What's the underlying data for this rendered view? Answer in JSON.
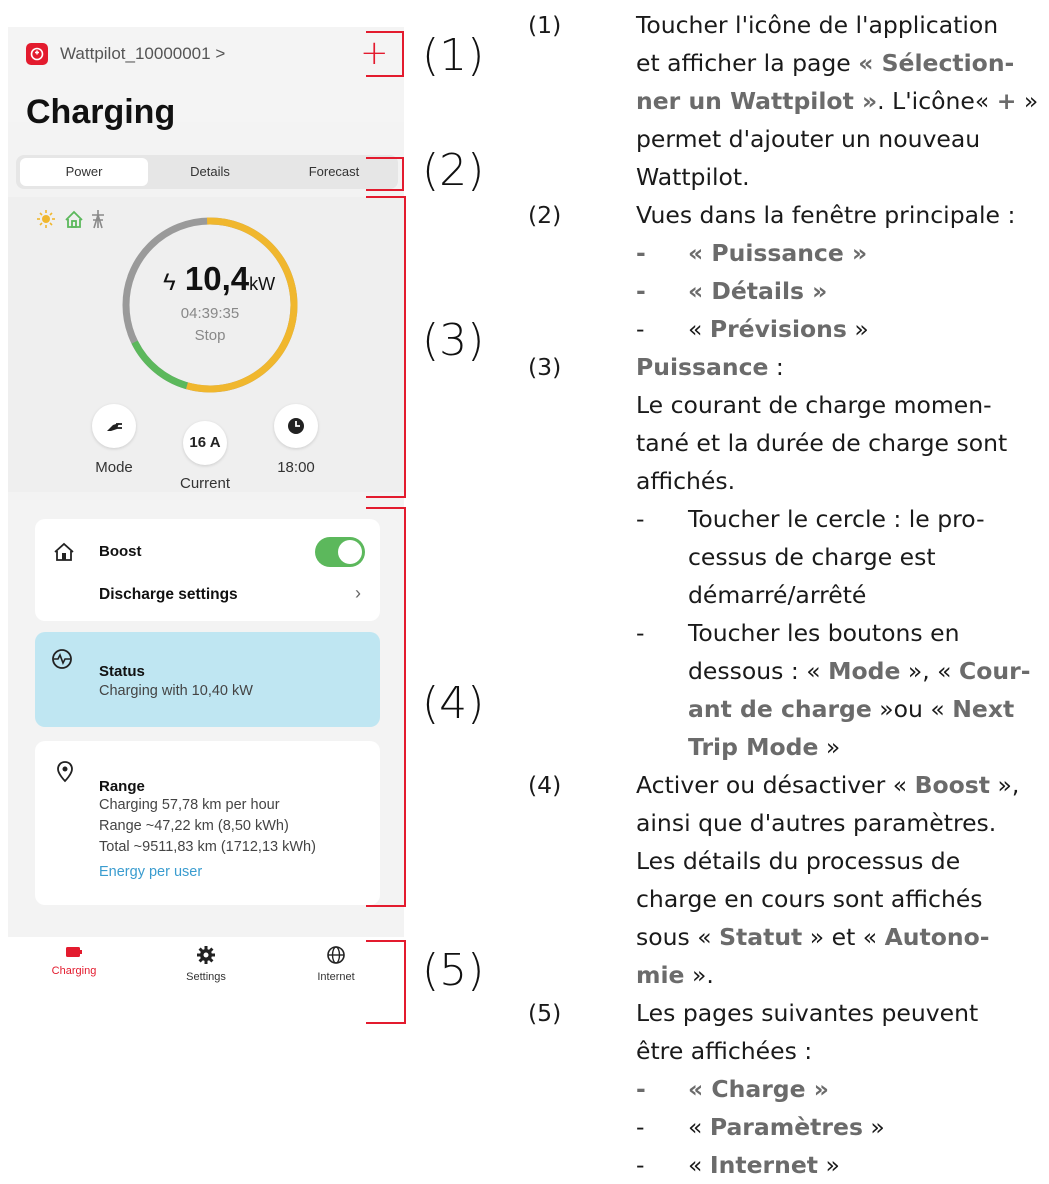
{
  "app": {
    "device_name": "Wattpilot_10000001 >",
    "add_label": "+",
    "page_title": "Charging"
  },
  "tabs": [
    "Power",
    "Details",
    "Forecast"
  ],
  "power": {
    "value": "10,4",
    "unit": "kW",
    "elapsed": "04:39:35",
    "action": "Stop",
    "mode_label": "Mode",
    "current_value": "16 A",
    "current_label": "Current",
    "timer_label": "18:00"
  },
  "boost_card": {
    "title": "Boost",
    "enabled": true,
    "discharge_label": "Discharge settings"
  },
  "status_card": {
    "title": "Status",
    "text": "Charging with 10,40 kW"
  },
  "range_card": {
    "title": "Range",
    "line1": "Charging 57,78 km per hour",
    "line2": "Range ~47,22 km (8,50 kWh)",
    "line3": "Total ~9511,83 km (1712,13 kWh)",
    "link": "Energy per user"
  },
  "nav": [
    "Charging",
    "Settings",
    "Internet"
  ],
  "markers": [
    "(1)",
    "(2)",
    "(3)",
    "(4)",
    "(5)"
  ],
  "colors": {
    "accent": "#e31b2e",
    "solar": "#f0b72e",
    "grid": "#8a8a8a",
    "battery": "#5cb85c",
    "status_bg": "#bfe6f2",
    "link": "#3a9ccf"
  },
  "text": {
    "s1": {
      "n": "(1)",
      "l1": "Toucher l'icône de l'application",
      "l2a": "et afficher la page ",
      "l2b": "« Sélection-",
      "l3a": "ner un Wattpilot »",
      "l3b": ". L'icône« ",
      "l3c": "+",
      "l3d": " »",
      "l4": "permet d'ajouter un nouveau",
      "l5": "Wattpilot."
    },
    "s2": {
      "n": "(2)",
      "l1": "Vues dans la fenêtre principale :",
      "i1": "« Puissance »",
      "i2": "« Détails »",
      "i3a": "« ",
      "i3b": "Prévisions",
      "i3c": " »"
    },
    "s3": {
      "n": "(3)",
      "l1": "Puissance",
      "l1b": " :",
      "l2": "Le courant de charge momen-",
      "l3": "tané et la durée de charge sont",
      "l4": "affichés.",
      "b1a": "Toucher le cercle : le pro-",
      "b1b": "cessus de charge est",
      "b1c": "démarré/arrêté",
      "b2a": "Toucher les boutons en",
      "b2b": "dessous : « ",
      "b2c": "Mode",
      "b2d": " », « ",
      "b2e": "Cour-",
      "b2f": "ant de charge",
      "b2g": " »ou « ",
      "b2h": "Next",
      "b2i": "Trip Mode",
      "b2j": " »"
    },
    "s4": {
      "n": "(4)",
      "l1a": "Activer ou désactiver « ",
      "l1b": "Boost",
      "l1c": " »,",
      "l2": "ainsi que d'autres paramètres.",
      "l3": "Les détails du processus de",
      "l4": "charge en cours sont affichés",
      "l5a": "sous « ",
      "l5b": "Statut",
      "l5c": " » et « ",
      "l5d": "Autono-",
      "l6a": "mie",
      "l6b": " »."
    },
    "s5": {
      "n": "(5)",
      "l1": "Les pages suivantes peuvent",
      "l2": "être affichées :",
      "i1": "« Charge »",
      "i2a": "« ",
      "i2b": "Paramètres",
      "i2c": " »",
      "i3a": "« ",
      "i3b": "Internet",
      "i3c": " »"
    }
  }
}
